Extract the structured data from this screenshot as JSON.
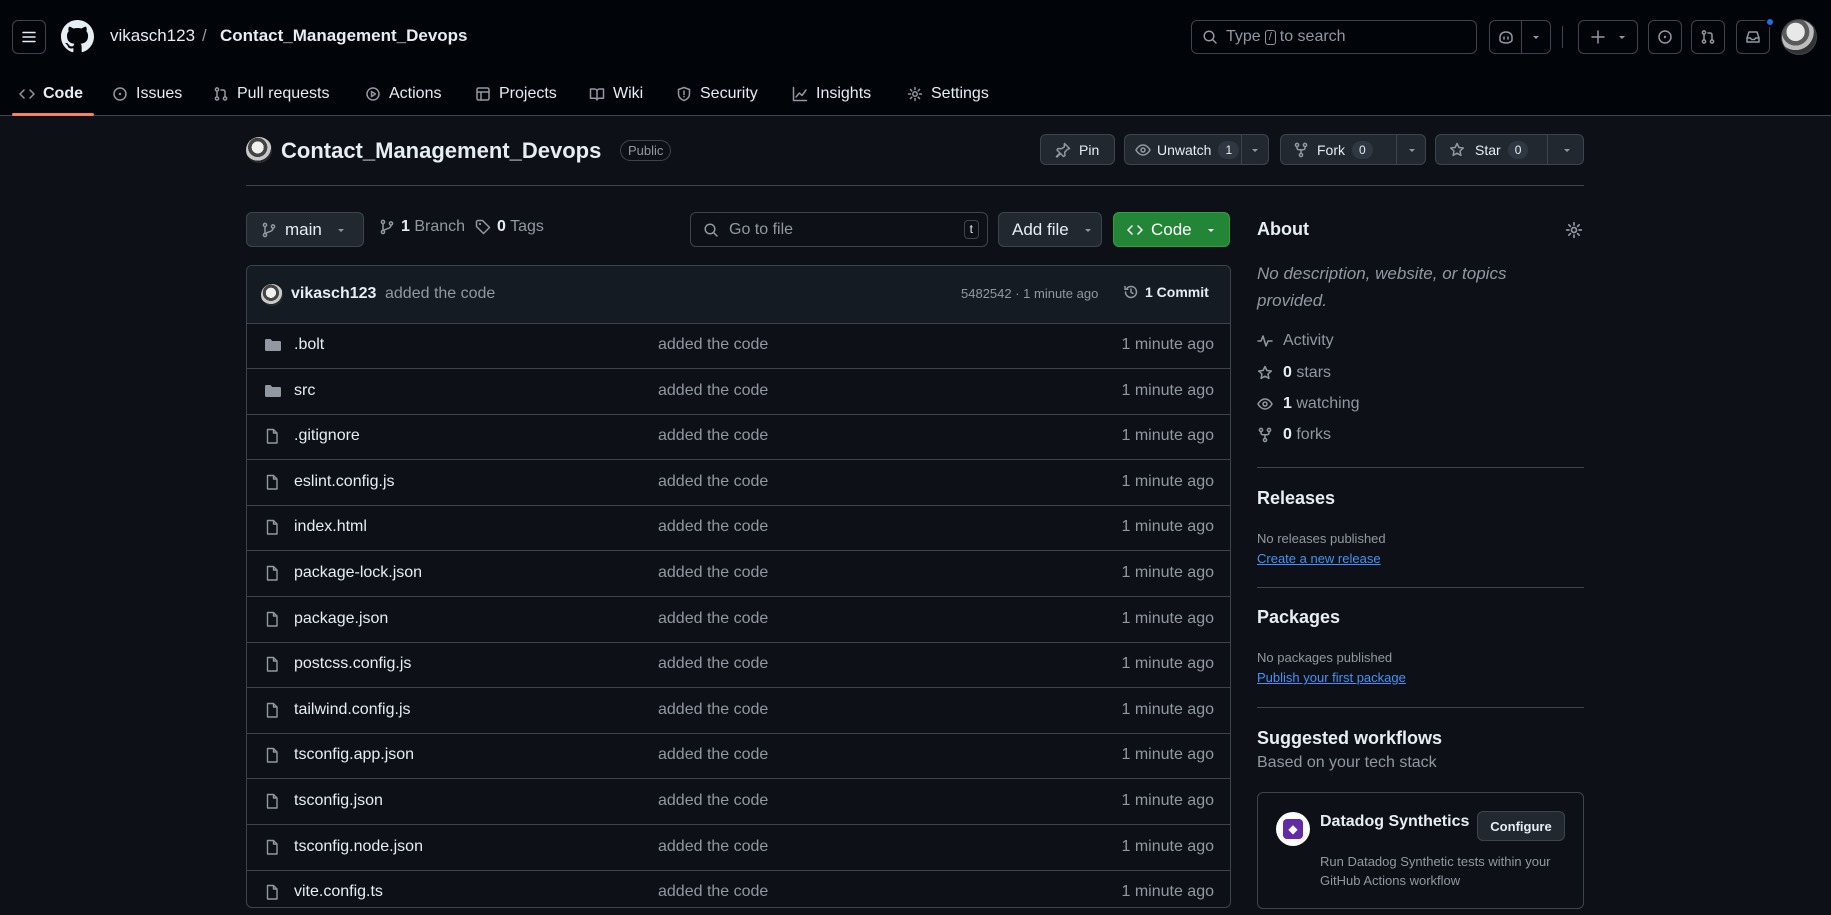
{
  "header": {
    "owner": "vikasch123",
    "separator": "/",
    "repo": "Contact_Management_Devops",
    "search": {
      "prefix": "Type",
      "key": "/",
      "suffix": "to search"
    }
  },
  "tabs": [
    {
      "label": "Code",
      "icon": "code-icon",
      "active": true
    },
    {
      "label": "Issues",
      "icon": "issue-opened-icon"
    },
    {
      "label": "Pull requests",
      "icon": "git-pull-request-icon"
    },
    {
      "label": "Actions",
      "icon": "play-icon"
    },
    {
      "label": "Projects",
      "icon": "table-icon"
    },
    {
      "label": "Wiki",
      "icon": "book-icon"
    },
    {
      "label": "Security",
      "icon": "shield-icon"
    },
    {
      "label": "Insights",
      "icon": "graph-icon"
    },
    {
      "label": "Settings",
      "icon": "gear-icon"
    }
  ],
  "repo_header": {
    "title": "Contact_Management_Devops",
    "visibility": "Public",
    "pin_label": "Pin",
    "watch_label": "Unwatch",
    "watch_count": "1",
    "fork_label": "Fork",
    "fork_count": "0",
    "star_label": "Star",
    "star_count": "0"
  },
  "toolbar": {
    "branch": "main",
    "branch_count": "1",
    "branch_label": "Branch",
    "tag_count": "0",
    "tag_label": "Tags",
    "goto_placeholder": "Go to file",
    "goto_key": "t",
    "add_file_label": "Add file",
    "code_label": "Code"
  },
  "latest_commit": {
    "author": "vikasch123",
    "message": "added the code",
    "meta": "5482542 · 1 minute ago",
    "commits_label": "1 Commit"
  },
  "files": [
    {
      "name": ".bolt",
      "type": "folder",
      "message": "added the code",
      "time": "1 minute ago"
    },
    {
      "name": "src",
      "type": "folder",
      "message": "added the code",
      "time": "1 minute ago"
    },
    {
      "name": ".gitignore",
      "type": "file",
      "message": "added the code",
      "time": "1 minute ago"
    },
    {
      "name": "eslint.config.js",
      "type": "file",
      "message": "added the code",
      "time": "1 minute ago"
    },
    {
      "name": "index.html",
      "type": "file",
      "message": "added the code",
      "time": "1 minute ago"
    },
    {
      "name": "package-lock.json",
      "type": "file",
      "message": "added the code",
      "time": "1 minute ago"
    },
    {
      "name": "package.json",
      "type": "file",
      "message": "added the code",
      "time": "1 minute ago"
    },
    {
      "name": "postcss.config.js",
      "type": "file",
      "message": "added the code",
      "time": "1 minute ago"
    },
    {
      "name": "tailwind.config.js",
      "type": "file",
      "message": "added the code",
      "time": "1 minute ago"
    },
    {
      "name": "tsconfig.app.json",
      "type": "file",
      "message": "added the code",
      "time": "1 minute ago"
    },
    {
      "name": "tsconfig.json",
      "type": "file",
      "message": "added the code",
      "time": "1 minute ago"
    },
    {
      "name": "tsconfig.node.json",
      "type": "file",
      "message": "added the code",
      "time": "1 minute ago"
    },
    {
      "name": "vite.config.ts",
      "type": "file",
      "message": "added the code",
      "time": "1 minute ago"
    }
  ],
  "about": {
    "title": "About",
    "description": "No description, website, or topics provided.",
    "activity_label": "Activity",
    "stars_count": "0",
    "stars_label": "stars",
    "watching_count": "1",
    "watching_label": "watching",
    "forks_count": "0",
    "forks_label": "forks"
  },
  "releases": {
    "title": "Releases",
    "empty": "No releases published",
    "link": "Create a new release"
  },
  "packages": {
    "title": "Packages",
    "empty": "No packages published",
    "link": "Publish your first package"
  },
  "workflows": {
    "title": "Suggested workflows",
    "subtitle": "Based on your tech stack",
    "card": {
      "name": "Datadog Synthetics",
      "button": "Configure",
      "description": "Run Datadog Synthetic tests within your GitHub Actions workflow"
    }
  },
  "colors": {
    "background": "#0d1117",
    "header": "#010409",
    "border": "#3d444d",
    "muted_text": "#9198a1",
    "accent_underline": "#f78166",
    "primary_button": "#238636",
    "link": "#4493f8"
  }
}
